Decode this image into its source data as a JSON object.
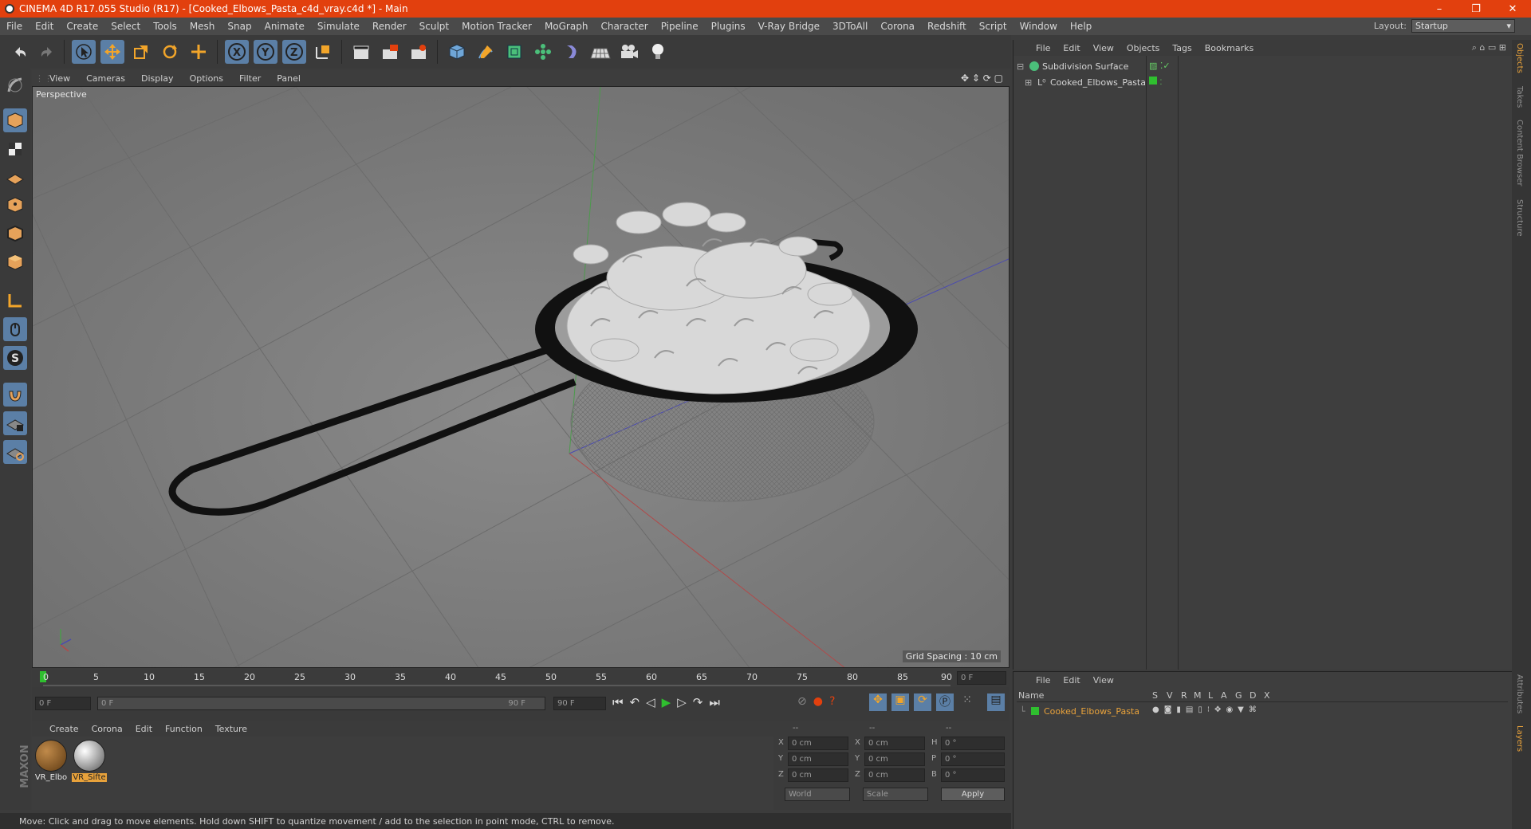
{
  "window": {
    "title": "CINEMA 4D R17.055 Studio (R17) - [Cooked_Elbows_Pasta_c4d_vray.c4d *] - Main",
    "minimize": "–",
    "restore": "❐",
    "close": "✕"
  },
  "menubar": {
    "items": [
      "File",
      "Edit",
      "Create",
      "Select",
      "Tools",
      "Mesh",
      "Snap",
      "Animate",
      "Simulate",
      "Render",
      "Sculpt",
      "Motion Tracker",
      "MoGraph",
      "Character",
      "Pipeline",
      "Plugins",
      "V-Ray Bridge",
      "3DToAll",
      "Corona",
      "Redshift",
      "Script",
      "Window",
      "Help"
    ],
    "layout_label": "Layout:",
    "layout_value": "Startup"
  },
  "viewport": {
    "menu": [
      "View",
      "Cameras",
      "Display",
      "Options",
      "Filter",
      "Panel"
    ],
    "label": "Perspective",
    "grid_spacing": "Grid Spacing : 10 cm"
  },
  "timeline": {
    "ticks": [
      "0",
      "5",
      "10",
      "15",
      "20",
      "25",
      "30",
      "35",
      "40",
      "45",
      "50",
      "55",
      "60",
      "65",
      "70",
      "75",
      "80",
      "85",
      "90"
    ],
    "current_frame": "0 F",
    "start_field": "0 F",
    "range_start": "0 F",
    "range_end": "90 F",
    "end_field": "90 F"
  },
  "materials": {
    "menu": [
      "Create",
      "Corona",
      "Edit",
      "Function",
      "Texture"
    ],
    "items": [
      {
        "label": "VR_Elbo",
        "color": "#8a5a22"
      },
      {
        "label": "VR_Sifte",
        "color": "#b8b8b8"
      }
    ]
  },
  "coords": {
    "headers": [
      "--",
      "--",
      "--"
    ],
    "rows": [
      {
        "a": "X",
        "av": "0 cm",
        "b": "X",
        "bv": "0 cm",
        "c": "H",
        "cv": "0 °"
      },
      {
        "a": "Y",
        "av": "0 cm",
        "b": "Y",
        "bv": "0 cm",
        "c": "P",
        "cv": "0 °"
      },
      {
        "a": "Z",
        "av": "0 cm",
        "b": "Z",
        "bv": "0 cm",
        "c": "B",
        "cv": "0 °"
      }
    ],
    "world": "World",
    "scale": "Scale",
    "apply": "Apply"
  },
  "status": "Move: Click and drag to move elements. Hold down SHIFT to quantize movement / add to the selection in point mode, CTRL to remove.",
  "objects": {
    "menu": [
      "File",
      "Edit",
      "View",
      "Objects",
      "Tags",
      "Bookmarks"
    ],
    "rows": [
      {
        "name": "Subdivision Surface"
      },
      {
        "name": "Cooked_Elbows_Pasta"
      }
    ]
  },
  "layers": {
    "menu": [
      "File",
      "Edit",
      "View"
    ],
    "columns": [
      "Name",
      "S",
      "V",
      "R",
      "M",
      "L",
      "A",
      "G",
      "D",
      "X"
    ],
    "rows": [
      {
        "name": "Cooked_Elbows_Pasta"
      }
    ]
  },
  "sidetabs": [
    "Objects",
    "Takes",
    "Content Browser",
    "Structure",
    "Attributes",
    "Layers"
  ],
  "colors": {
    "accent": "#e2400e",
    "active_tool": "#5b7fa6",
    "layer_green": "#2fbf2f",
    "label_orange": "#e8a23b"
  }
}
